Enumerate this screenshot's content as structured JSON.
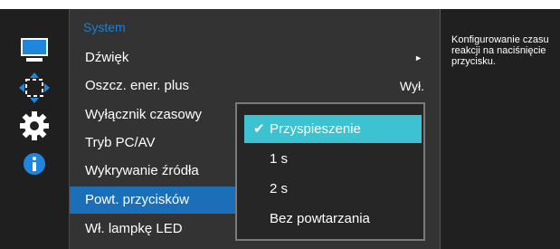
{
  "menu": {
    "title": "System",
    "items": [
      {
        "label": "Dźwięk",
        "value": "",
        "arrow": "►"
      },
      {
        "label": "Oszcz. ener. plus",
        "value": "Wył.",
        "arrow": ""
      },
      {
        "label": "Wyłącznik czasowy",
        "value": "",
        "arrow": ""
      },
      {
        "label": "Tryb PC/AV",
        "value": "",
        "arrow": ""
      },
      {
        "label": "Wykrywanie źródła",
        "value": "",
        "arrow": ""
      },
      {
        "label": "Powt. przycisków",
        "value": "",
        "arrow": ""
      },
      {
        "label": "Wł. lampkę LED",
        "value": "",
        "arrow": ""
      }
    ],
    "selected_index": 5
  },
  "popup": {
    "options": [
      "Przyspieszenie",
      "1 s",
      "2 s",
      "Bez powtarzania"
    ],
    "active_index": 0,
    "check_glyph": "✔"
  },
  "info": {
    "text": "Konfigurowanie czasu reakcji na naciśnięcie przycisku."
  },
  "sidebar": {
    "icons": [
      "monitor-icon",
      "move-arrows-icon",
      "gear-icon",
      "info-icon"
    ]
  },
  "colors": {
    "title_blue": "#1f7fd0",
    "selected_blue": "#1b6fb8",
    "popup_active": "#3cc2d0"
  }
}
